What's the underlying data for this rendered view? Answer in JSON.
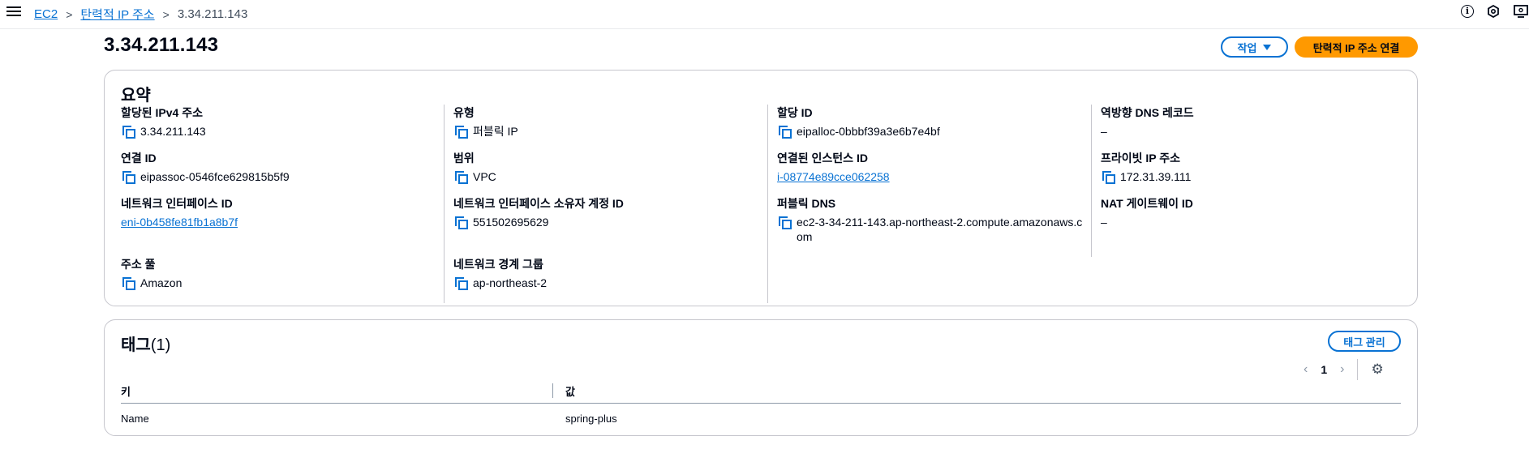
{
  "breadcrumb": {
    "items": [
      "EC2",
      "탄력적 IP 주소"
    ],
    "current": "3.34.211.143",
    "separator": ">"
  },
  "top_icons": [
    "info-icon",
    "notifications-icon",
    "settings-icon"
  ],
  "page": {
    "title": "3.34.211.143",
    "actions_label": "작업",
    "primary_label": "탄력적 IP 주소 연결"
  },
  "summary": {
    "title": "요약",
    "allocated_ipv4": {
      "label": "할당된 IPv4 주소",
      "value": "3.34.211.143"
    },
    "association_id": {
      "label": "연결 ID",
      "value": "eipassoc-0546fce629815b5f9"
    },
    "network_interface_id": {
      "label": "네트워크 인터페이스 ID",
      "value": "eni-0b458fe81fb1a8b7f"
    },
    "address_pool": {
      "label": "주소 풀",
      "value": "Amazon"
    },
    "type": {
      "label": "유형",
      "value": "퍼블릭 IP"
    },
    "scope": {
      "label": "범위",
      "value": "VPC"
    },
    "ni_owner": {
      "label": "네트워크 인터페이스 소유자 계정 ID",
      "value": "551502695629"
    },
    "network_border_group": {
      "label": "네트워크 경계 그룹",
      "value": "ap-northeast-2"
    },
    "allocation_id": {
      "label": "할당 ID",
      "value": "eipalloc-0bbbf39a3e6b7e4bf"
    },
    "associated_instance_id": {
      "label": "연결된 인스턴스 ID",
      "value": "i-08774e89cce062258"
    },
    "public_dns": {
      "label": "퍼블릭 DNS",
      "value": "ec2-3-34-211-143.ap-northeast-2.compute.amazonaws.com"
    },
    "reverse_dns": {
      "label": "역방향 DNS 레코드",
      "value": "–"
    },
    "private_ip": {
      "label": "프라이빗 IP 주소",
      "value": "172.31.39.111"
    },
    "nat_gateway_id": {
      "label": "NAT 게이트웨이 ID",
      "value": "–"
    }
  },
  "tags": {
    "title": "태그",
    "count": "(1)",
    "manage_label": "태그 관리",
    "page_number": "1",
    "columns": [
      "키",
      "값"
    ],
    "rows": [
      [
        "Name",
        "spring-plus"
      ]
    ]
  },
  "colors": {
    "accent": "#0972d3",
    "primary_button": "#ff9900",
    "border": "#c6c6cd",
    "text": "#000716"
  }
}
